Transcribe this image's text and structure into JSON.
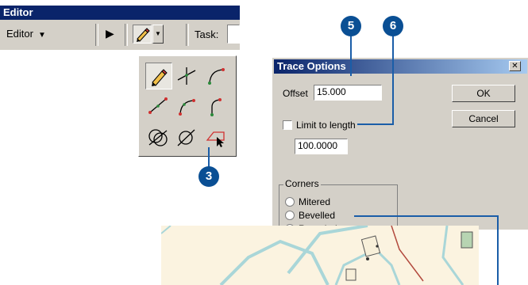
{
  "editor_toolbar": {
    "title": "Editor",
    "editor_menu_label": "Editor",
    "task_label": "Task:"
  },
  "trace_dialog": {
    "title": "Trace Options",
    "offset_label": "Offset",
    "offset_value": "15.000",
    "limit_to_length_label": "Limit to length",
    "limit_to_length_checked": false,
    "length_value": "100.0000",
    "ok_label": "OK",
    "cancel_label": "Cancel",
    "corners_group_label": "Corners",
    "corner_options": [
      "Mitered",
      "Bevelled",
      "Rounded"
    ]
  },
  "callouts": {
    "step_5": "5",
    "step_6": "6",
    "step_3": "3"
  },
  "colors": {
    "titlebar": "#0a246a",
    "callout": "#0a4f94",
    "leader_line": "#1a5da8",
    "map_background": "#fbf3e0",
    "parcel_outline": "#a9d6d8",
    "building_fill": "#b7d4b2"
  }
}
